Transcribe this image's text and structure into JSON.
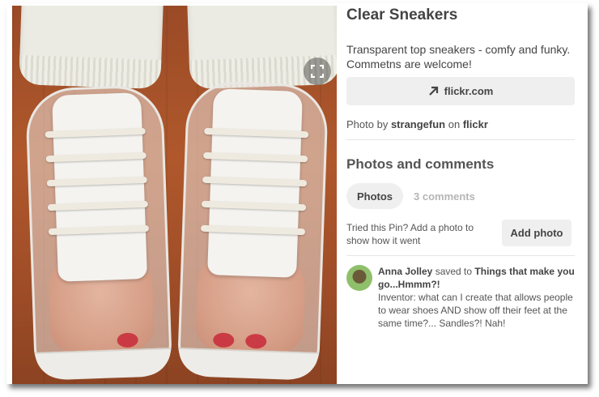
{
  "pin": {
    "title": "Clear Sneakers",
    "description": "Transparent top sneakers - comfy and funky. Commetns are welcome!",
    "source_link": "flickr.com",
    "credit_prefix": "Photo by",
    "credit_user": "strangefun",
    "credit_on": "on",
    "credit_site": "flickr"
  },
  "photos_and_comments": {
    "heading": "Photos and comments",
    "tab_photos": "Photos",
    "tab_comments": "3 comments",
    "tried_text": "Tried this Pin? Add a photo to show how it went",
    "add_photo": "Add photo"
  },
  "comment": {
    "user": "Anna Jolley",
    "saved_to": "saved to",
    "board": "Things that make you go...Hmmm?!",
    "text": "Inventor: what can I create that allows people to wear shoes AND show off their feet at the same time?... Sandles?! Nah!"
  },
  "icons": {
    "expand": "expand-icon",
    "link_arrow": "arrow-up-right-icon",
    "avatar": "avatar"
  }
}
